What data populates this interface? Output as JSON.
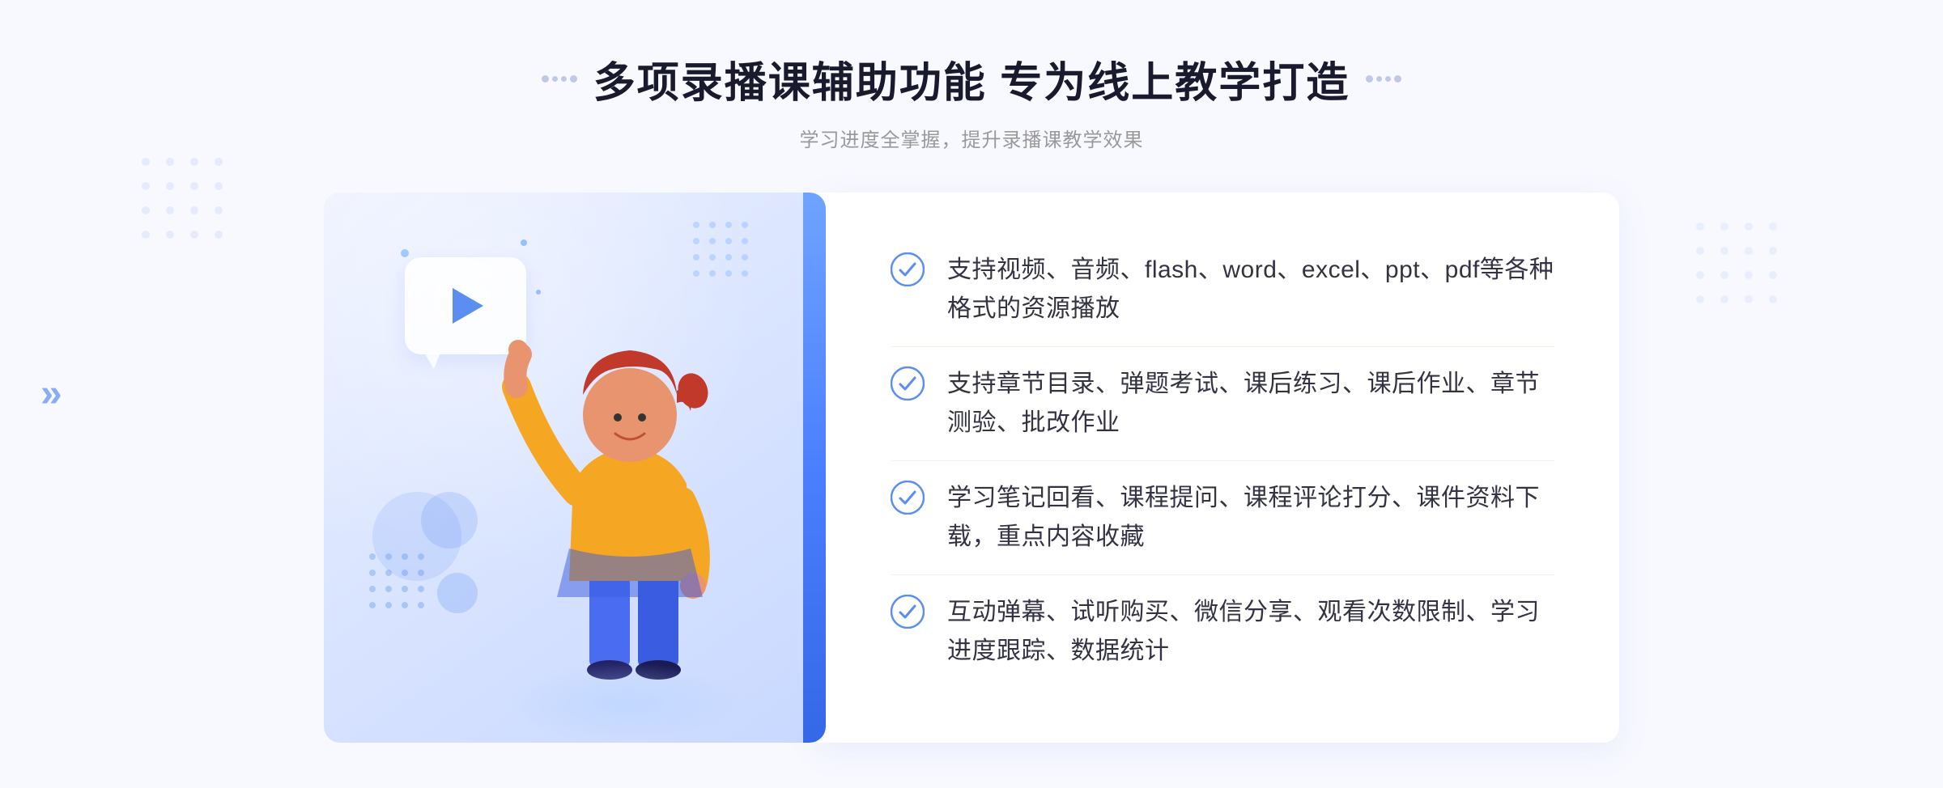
{
  "header": {
    "title": "多项录播课辅助功能 专为线上教学打造",
    "subtitle": "学习进度全掌握，提升录播课教学效果",
    "title_dots_label": "decorative dots"
  },
  "features": [
    {
      "id": 1,
      "text": "支持视频、音频、flash、word、excel、ppt、pdf等各种格式的资源播放"
    },
    {
      "id": 2,
      "text": "支持章节目录、弹题考试、课后练习、课后作业、章节测验、批改作业"
    },
    {
      "id": 3,
      "text": "学习笔记回看、课程提问、课程评论打分、课件资料下载，重点内容收藏"
    },
    {
      "id": 4,
      "text": "互动弹幕、试听购买、微信分享、观看次数限制、学习进度跟踪、数据统计"
    }
  ],
  "colors": {
    "accent_blue": "#4b7fff",
    "light_blue": "#6fa3ff",
    "text_dark": "#1a1a2e",
    "text_sub": "#999999",
    "check_color": "#5b8ef0"
  },
  "illustration": {
    "play_label": "play button",
    "person_label": "person pointing up illustration"
  }
}
